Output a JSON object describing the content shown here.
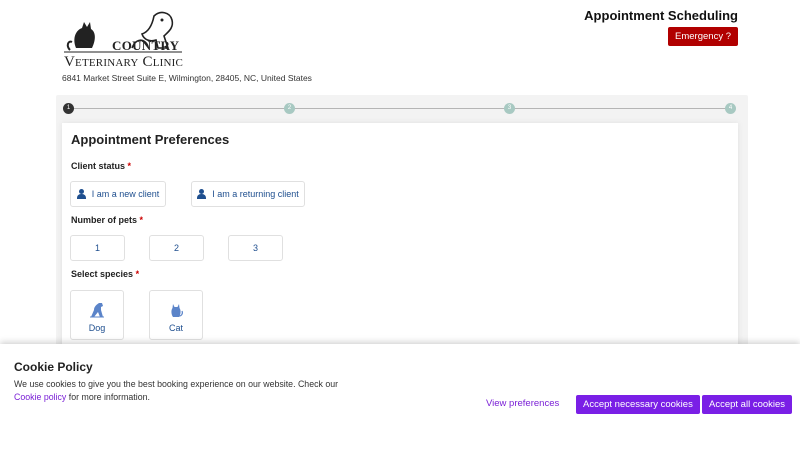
{
  "header": {
    "logo_line1": "Country",
    "logo_line2": "Veterinary Clinic",
    "address": "6841 Market Street Suite E, Wilmington, 28405, NC, United States",
    "title": "Appointment Scheduling",
    "emergency_label": "Emergency ?"
  },
  "stepper": {
    "steps": [
      "1",
      "2",
      "3",
      "4"
    ],
    "active_step": 1
  },
  "form": {
    "title": "Appointment Preferences",
    "client_status": {
      "label": "Client status",
      "required_mark": "*",
      "options": [
        "I am a new client",
        "I am a returning client"
      ]
    },
    "pets": {
      "label": "Number of pets",
      "required_mark": "*",
      "options": [
        "1",
        "2",
        "3"
      ]
    },
    "species": {
      "label": "Select species",
      "required_mark": "*",
      "options": [
        "Dog",
        "Cat"
      ]
    }
  },
  "cookie": {
    "title": "Cookie Policy",
    "text_before": "We use cookies to give you the best booking experience on our website. Check our",
    "link_text": "Cookie policy",
    "text_after": "for more information.",
    "view_preferences": "View preferences",
    "accept_necessary": "Accept necessary cookies",
    "accept_all": "Accept all cookies"
  },
  "colors": {
    "emergency": "#b10000",
    "cookie_accent": "#7a1fe6",
    "link_blue": "#1f4f8f",
    "step_inactive": "#a8c9c2"
  }
}
